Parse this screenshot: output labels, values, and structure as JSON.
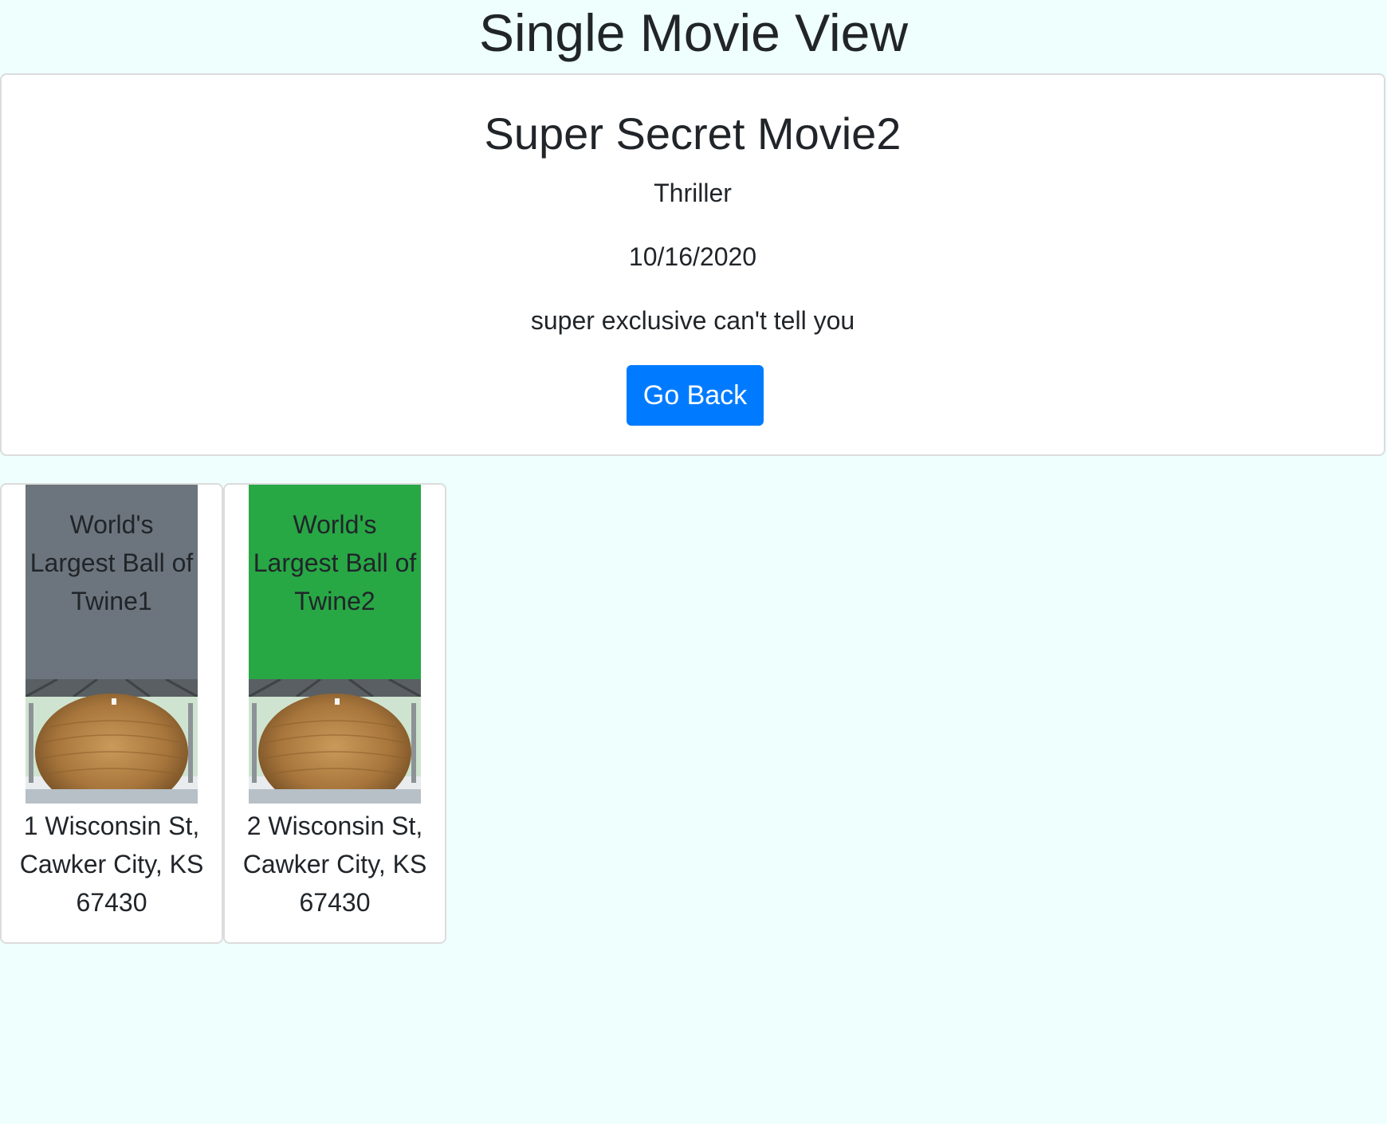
{
  "page": {
    "title": "Single Movie View"
  },
  "movie": {
    "title": "Super Secret Movie2",
    "genre": "Thriller",
    "release_date": "10/16/2020",
    "description": "super exclusive can't tell you",
    "back_button_label": "Go Back"
  },
  "locations": [
    {
      "name": "World's Largest Ball of Twine1",
      "address": "1 Wisconsin St, Cawker City, KS 67430",
      "header_color": "#6c757d",
      "image": "ball-of-twine-photo"
    },
    {
      "name": "World's Largest Ball of Twine2",
      "address": "2 Wisconsin St, Cawker City, KS 67430",
      "header_color": "#28a745",
      "image": "ball-of-twine-photo"
    }
  ],
  "colors": {
    "page_background": "#eefffe",
    "primary_button": "#007bff"
  }
}
